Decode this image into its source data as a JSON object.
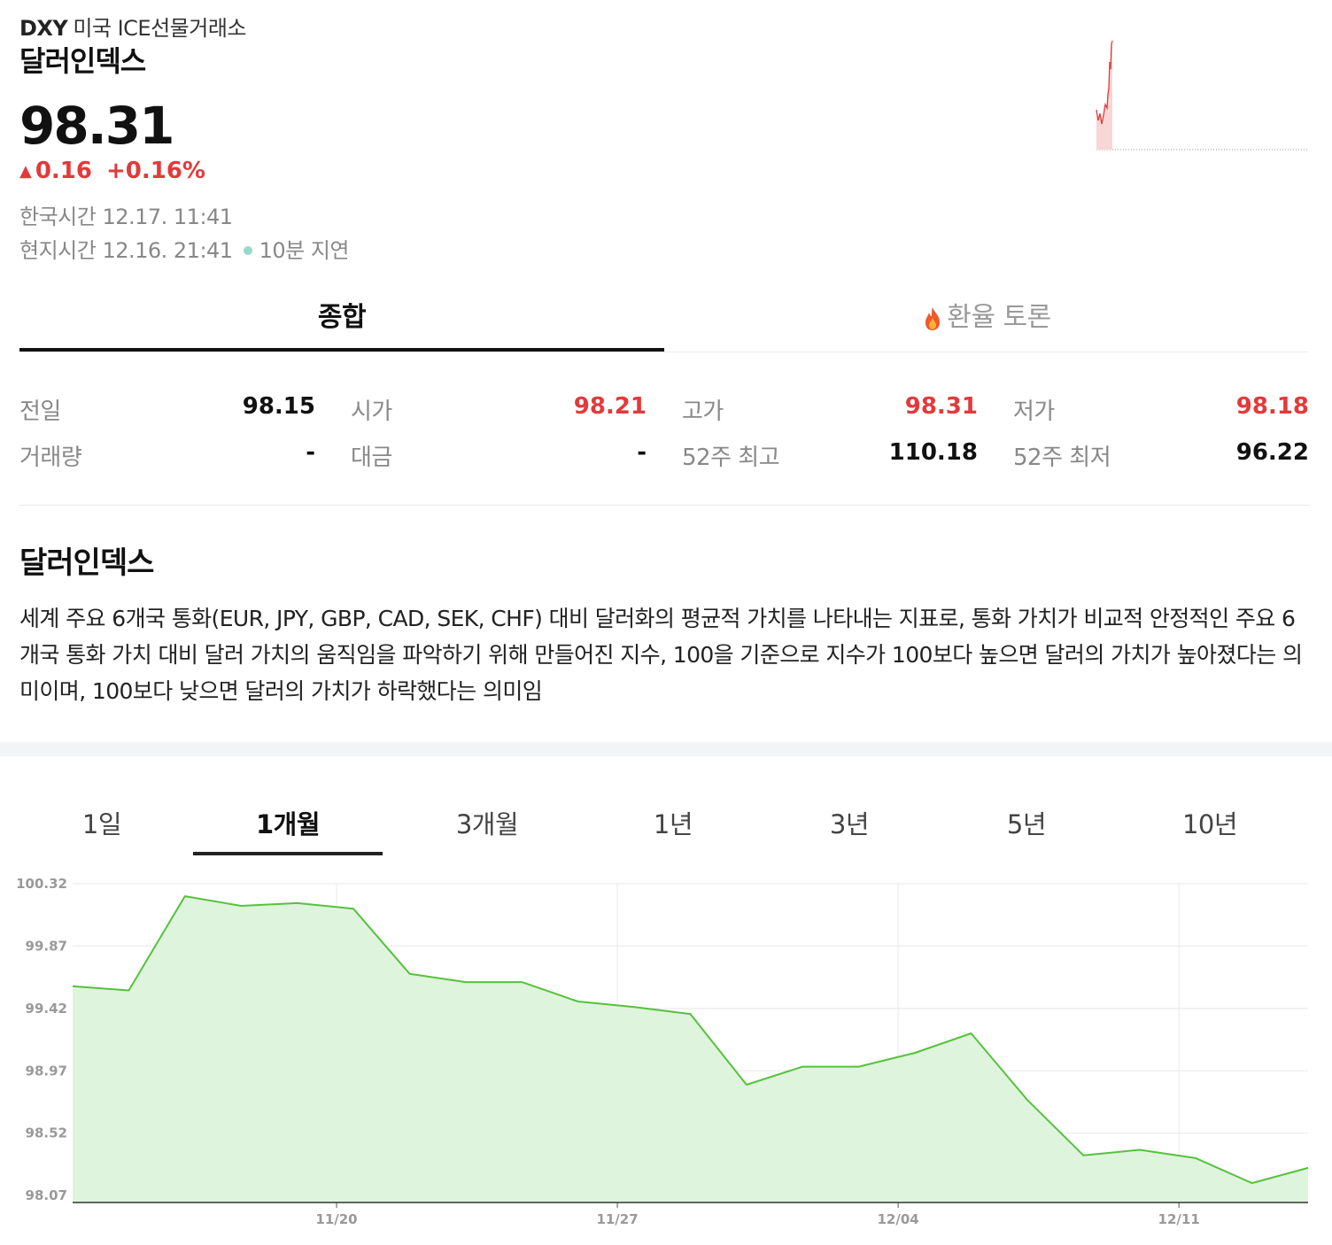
{
  "header": {
    "symbol": "DXY",
    "exchange": "미국 ICE선물거래소",
    "name": "달러인덱스",
    "price": "98.31",
    "change_arrow": "▲",
    "change": "0.16",
    "change_pct": "+0.16%",
    "kst_time": "한국시간 12.17. 11:41",
    "local_time": "현지시간 12.16. 21:41",
    "delay": "10분 지연"
  },
  "tabs": [
    {
      "label": "종합",
      "active": true
    },
    {
      "label": "환율 토론",
      "icon": "fire-icon",
      "active": false
    }
  ],
  "stats": {
    "prev_close": {
      "label": "전일",
      "value": "98.15"
    },
    "open": {
      "label": "시가",
      "value": "98.21"
    },
    "high": {
      "label": "고가",
      "value": "98.31"
    },
    "low": {
      "label": "저가",
      "value": "98.18"
    },
    "volume": {
      "label": "거래량",
      "value": "-"
    },
    "amount": {
      "label": "대금",
      "value": "-"
    },
    "high_52w": {
      "label": "52주 최고",
      "value": "110.18"
    },
    "low_52w": {
      "label": "52주 최저",
      "value": "96.22"
    }
  },
  "description": {
    "title": "달러인덱스",
    "text": "세계 주요 6개국 통화(EUR, JPY, GBP, CAD, SEK, CHF) 대비 달러화의 평균적 가치를 나타내는 지표로, 통화 가치가 비교적 안정적인 주요 6개국 통화 가치 대비 달러 가치의 움직임을 파악하기 위해 만들어진 지수, 100을 기준으로 지수가 100보다 높으면 달러의 가치가 높아졌다는 의미이며, 100보다 낮으면 달러의 가치가 하락했다는 의미임"
  },
  "periods": [
    {
      "label": "1일",
      "active": false
    },
    {
      "label": "1개월",
      "active": true
    },
    {
      "label": "3개월",
      "active": false
    },
    {
      "label": "1년",
      "active": false
    },
    {
      "label": "3년",
      "active": false
    },
    {
      "label": "5년",
      "active": false
    },
    {
      "label": "10년",
      "active": false
    }
  ],
  "colors": {
    "up": "#e23a3a",
    "line": "#55c23d",
    "fill": "#dff4dc"
  },
  "chart_data": {
    "type": "area",
    "x_tick_labels": [
      "11/20",
      "11/27",
      "12/04",
      "12/11"
    ],
    "y_tick_labels": [
      "100.32",
      "99.87",
      "99.42",
      "98.97",
      "98.52",
      "98.07"
    ],
    "ylim": [
      98.02,
      100.32
    ],
    "grid": true,
    "series": [
      {
        "values": [
          99.58,
          99.55,
          100.23,
          100.16,
          100.18,
          100.14,
          99.67,
          99.61,
          99.61,
          99.47,
          99.43,
          99.38,
          98.87,
          99.0,
          99.0,
          99.1,
          99.24,
          98.76,
          98.36,
          98.4,
          98.34,
          98.16,
          98.27
        ]
      }
    ]
  }
}
